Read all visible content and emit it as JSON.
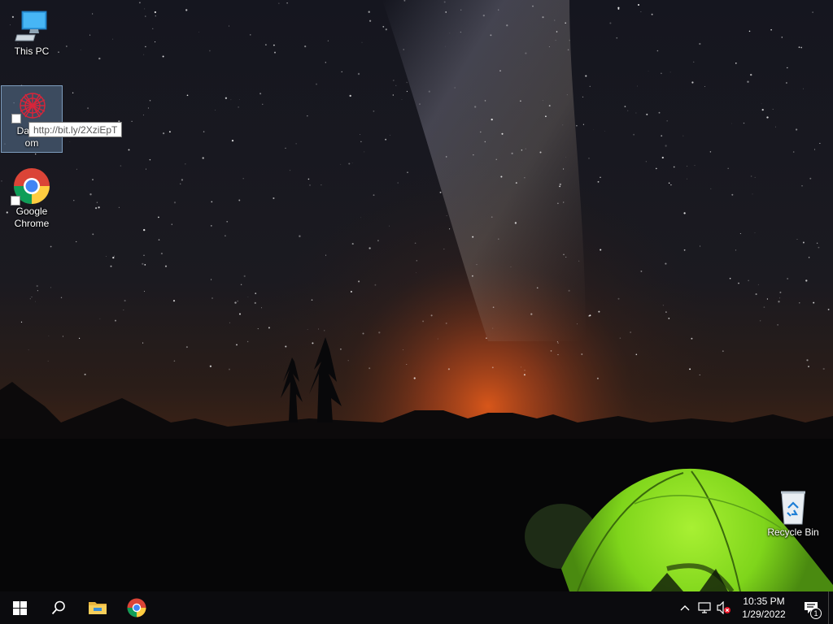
{
  "desktop": {
    "icons": [
      {
        "label": "This PC",
        "icon": "this-pc-icon"
      },
      {
        "label": "DataW…om",
        "label_top": "DataW",
        "label_bottom": "om",
        "icon": "datawrapper-icon",
        "tooltip": "http://bit.ly/2XziEpT"
      },
      {
        "label_top": "Google",
        "label_bottom": "Chrome",
        "icon": "chrome-icon"
      },
      {
        "label": "Recycle Bin",
        "icon": "recycle-bin-icon"
      }
    ]
  },
  "taskbar": {
    "pinned": [
      {
        "name": "start",
        "icon": "windows-logo-icon"
      },
      {
        "name": "search",
        "icon": "search-icon"
      },
      {
        "name": "file-explorer",
        "icon": "folder-icon"
      },
      {
        "name": "google-chrome",
        "icon": "chrome-icon"
      }
    ],
    "tray": {
      "icons": [
        "chevron-up-icon",
        "network-icon",
        "volume-muted-icon"
      ],
      "time": "10:35 PM",
      "date": "1/29/2022",
      "notification_count": "1"
    }
  },
  "colors": {
    "taskbar_bg": "#0b0b0e",
    "tent_green": "#7fd51b",
    "horizon_glow": "#e0591a"
  }
}
